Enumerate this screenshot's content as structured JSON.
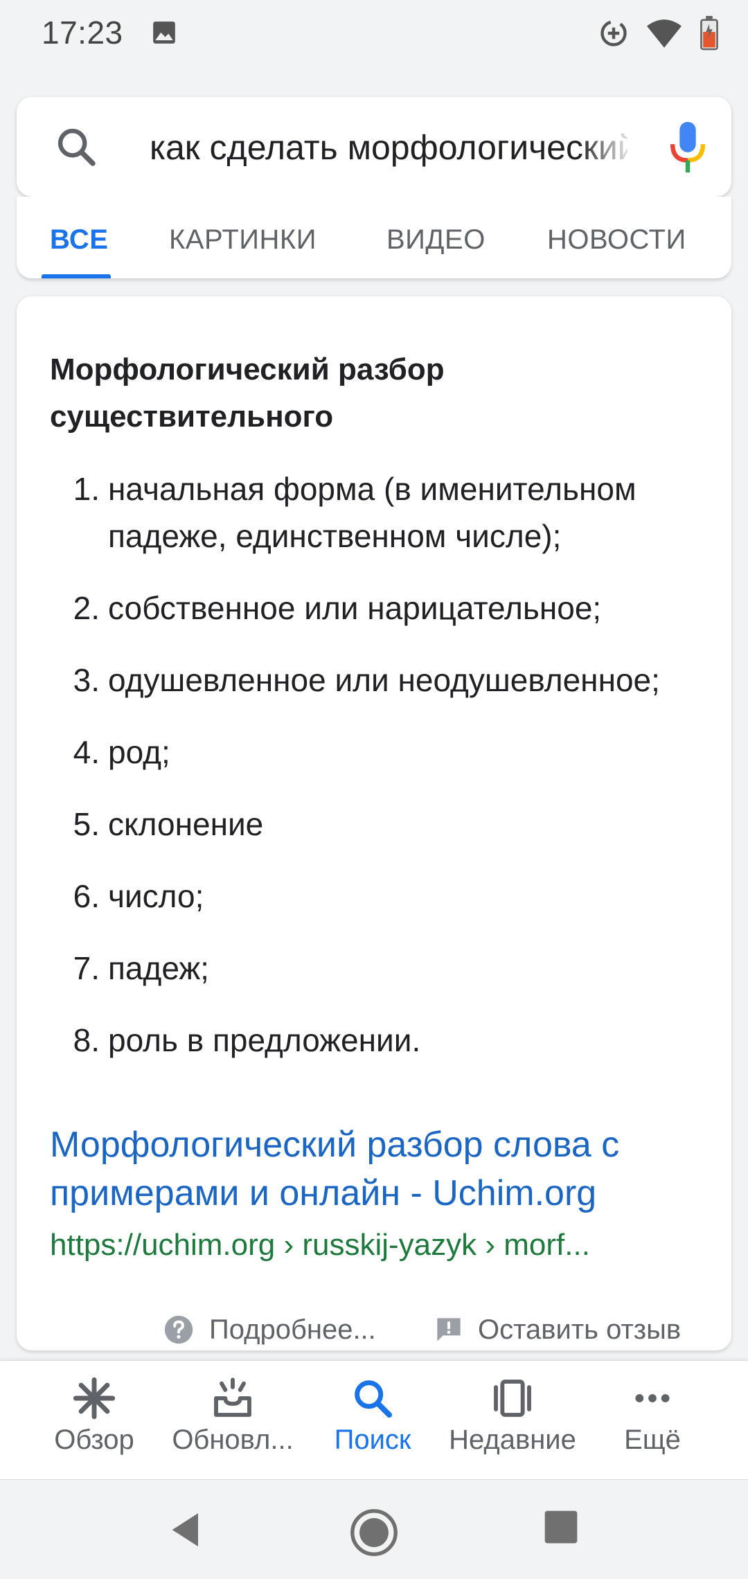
{
  "status_bar": {
    "time": "17:23",
    "icons": [
      "image-icon",
      "data-saver-icon",
      "wifi-icon",
      "battery-icon"
    ]
  },
  "search": {
    "query": "как сделать морфологический разбор существительного",
    "icons": [
      "search-icon",
      "mic-icon"
    ]
  },
  "tabs": [
    {
      "label": "ВСЕ",
      "active": true
    },
    {
      "label": "КАРТИНКИ",
      "active": false
    },
    {
      "label": "ВИДЕО",
      "active": false
    },
    {
      "label": "НОВОСТИ",
      "active": false
    }
  ],
  "snippet": {
    "title": "Морфологический разбор существительного",
    "items": [
      {
        "num": "1.",
        "text": "начальная форма (в именительном падеже, единственном числе);"
      },
      {
        "num": "2.",
        "text": "собственное или нарицательное;"
      },
      {
        "num": "3.",
        "text": "одушевленное или неодушевленное;"
      },
      {
        "num": "4.",
        "text": "род;"
      },
      {
        "num": "5.",
        "text": "склонение"
      },
      {
        "num": "6.",
        "text": "число;"
      },
      {
        "num": "7.",
        "text": "падеж;"
      },
      {
        "num": "8.",
        "text": "роль в предложении."
      }
    ],
    "link_title": "Морфологический разбор слова с примерами и онлайн - Uchim.org",
    "url": "https://uchim.org › russkij-yazyk › morf...",
    "more_label": "Подробнее...",
    "feedback_label": "Оставить отзыв"
  },
  "bottom_nav": [
    {
      "label": "Обзор",
      "icon": "discover-icon",
      "active": false
    },
    {
      "label": "Обновл...",
      "icon": "updates-icon",
      "active": false
    },
    {
      "label": "Поиск",
      "icon": "search-icon",
      "active": true
    },
    {
      "label": "Недавние",
      "icon": "recent-icon",
      "active": false
    },
    {
      "label": "Ещё",
      "icon": "more-icon",
      "active": false
    }
  ],
  "system_nav": [
    "back-icon",
    "home-icon",
    "overview-icon"
  ],
  "colors": {
    "accent": "#1a73e8",
    "link": "#1a66c2",
    "url": "#1e7a3c",
    "background": "#f1f3f4"
  }
}
